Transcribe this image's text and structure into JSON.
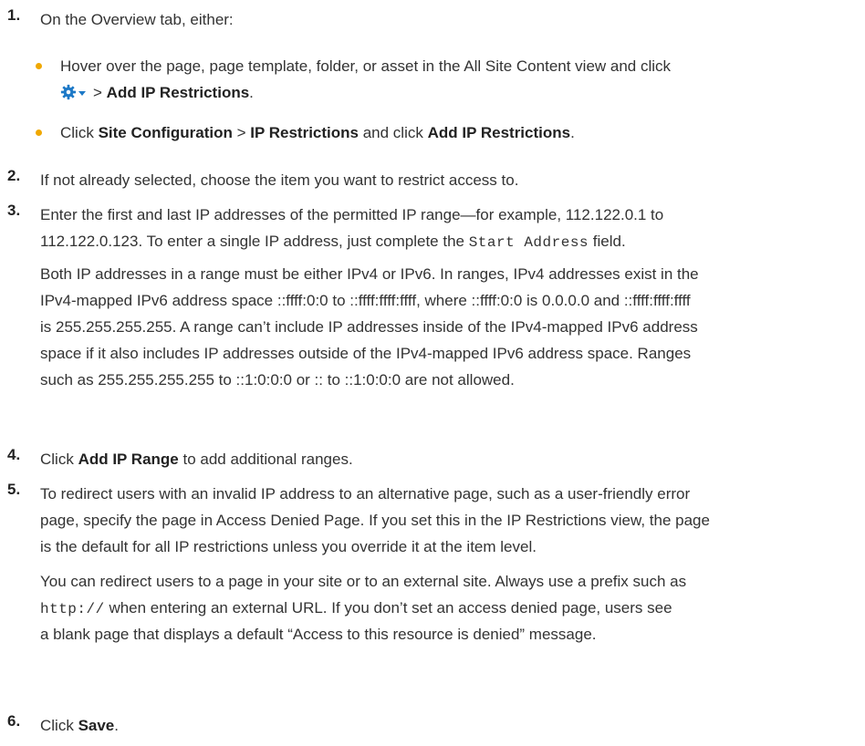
{
  "steps": [
    {
      "num": "1.",
      "intro": "On the Overview tab, either:",
      "bullets": [
        {
          "line1": "Hover over the page, page template, folder, or asset in the All Site Content view and click",
          "sep": ">",
          "bold": "Add IP Restrictions",
          "end": ".",
          "icon": "gear-icon"
        },
        {
          "pre": "Click ",
          "b1": "Site Configuration",
          "sep": " > ",
          "b2": "IP Restrictions",
          "mid": " and click ",
          "b3": "Add IP Restrictions",
          "end": "."
        }
      ]
    },
    {
      "num": "2.",
      "text": "If not already selected, choose the item you want to restrict access to."
    },
    {
      "num": "3.",
      "l1": "Enter the first and last IP addresses of the permitted IP range—for example, 112.122.0.1 to",
      "l2a": "112.122.0.123. To enter a single IP address, just complete the ",
      "l2code": "Start Address",
      "l2b": " field.",
      "para": [
        "Both IP addresses in a range must be either IPv4 or IPv6. In ranges, IPv4 addresses exist in the",
        "IPv4-mapped IPv6 address space ::ffff:0:0 to ::ffff:ffff:ffff, where ::ffff:0:0 is 0.0.0.0 and ::ffff:ffff:ffff",
        "is 255.255.255.255. A range can’t include IP addresses inside of the IPv4-mapped IPv6 address",
        "space if it also includes IP addresses outside of the IPv4-mapped IPv6 address space. Ranges",
        "such as 255.255.255.255 to ::1:0:0:0 or :: to ::1:0:0:0 are not allowed."
      ]
    },
    {
      "num": "4.",
      "pre": "Click ",
      "bold": "Add IP Range",
      "post": " to add additional ranges."
    },
    {
      "num": "5.",
      "lines": [
        "To redirect users with an invalid IP address to an alternative page, such as a user-friendly error",
        "page, specify the page in Access Denied Page. If you set this in the IP Restrictions view, the page",
        "is the default for all IP restrictions unless you override it at the item level."
      ],
      "p2l1": "You can redirect users to a page in your site or to an external site. Always use a prefix such as",
      "p2code": "http://",
      "p2l2b": " when entering an external URL. If you don’t set an access denied page, users see",
      "p2l3": "a blank page that displays a default “Access to this resource is denied” message."
    },
    {
      "num": "6.",
      "pre": "Click ",
      "bold": "Save",
      "post": "."
    }
  ],
  "colors": {
    "bullet": "#f0a800",
    "gear": "#1d79c7"
  }
}
